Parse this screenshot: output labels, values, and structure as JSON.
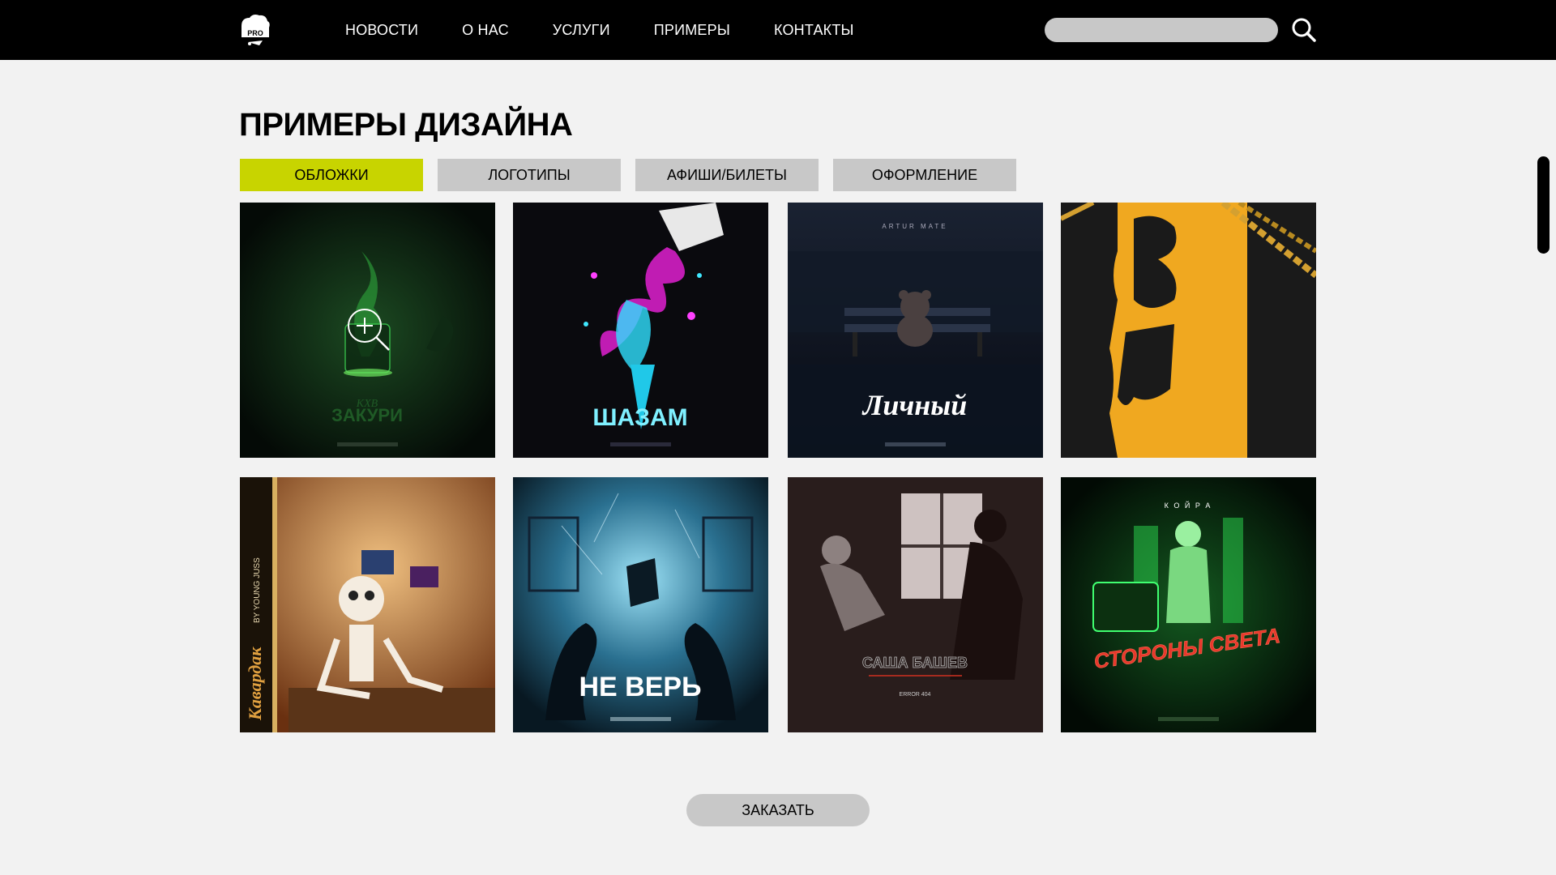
{
  "header": {
    "logo_icon": "brand-logo-icon",
    "nav": [
      "НОВОСТИ",
      "О НАС",
      "УСЛУГИ",
      "ПРИМЕРЫ",
      "КОНТАКТЫ"
    ],
    "search_placeholder": "",
    "search_icon": "search-icon"
  },
  "main": {
    "title": "ПРИМЕРЫ ДИЗАЙНА",
    "tabs": [
      {
        "label": "ОБЛОЖКИ",
        "active": true
      },
      {
        "label": "ЛОГОТИПЫ",
        "active": false
      },
      {
        "label": "АФИШИ/БИЛЕТЫ",
        "active": false
      },
      {
        "label": "ОФОРМЛЕНИЕ",
        "active": false
      }
    ],
    "covers": [
      {
        "name": "cover-zakuri",
        "caption": "ЗАКУРИ",
        "subcaption": "KXB",
        "theme": "green-smoke",
        "hover_icon": "zoom-in-icon"
      },
      {
        "name": "cover-shazam",
        "caption": "ШАЗАМ",
        "subcaption": "",
        "theme": "neon-splash"
      },
      {
        "name": "cover-lichnyi",
        "caption": "Личный",
        "subcaption": "ARTUR MATE",
        "theme": "night-bench"
      },
      {
        "name": "cover-yellow-chains",
        "caption": "",
        "subcaption": "",
        "theme": "yellow-drip"
      },
      {
        "name": "cover-kavardak",
        "caption": "Кавардак",
        "subcaption": "BY YOUNG JUSS",
        "theme": "skeleton-room"
      },
      {
        "name": "cover-ne-ver",
        "caption": "НЕ ВЕРЬ",
        "subcaption": "",
        "theme": "blue-hands"
      },
      {
        "name": "cover-sasha-bashev",
        "caption": "САША БАШЕВ",
        "subcaption": "ERROR 404",
        "theme": "bw-window"
      },
      {
        "name": "cover-storony-sveta",
        "caption": "СТОРОНЫ СВЕТА",
        "subcaption": "К О Й Р А",
        "theme": "green-neon-statue"
      }
    ],
    "order_label": "ЗАКАЗАТЬ"
  },
  "colors": {
    "header_bg": "#000000",
    "page_bg": "#f2f2f2",
    "tab_active": "#c8d400",
    "tab_inactive": "#c8c8c8"
  }
}
